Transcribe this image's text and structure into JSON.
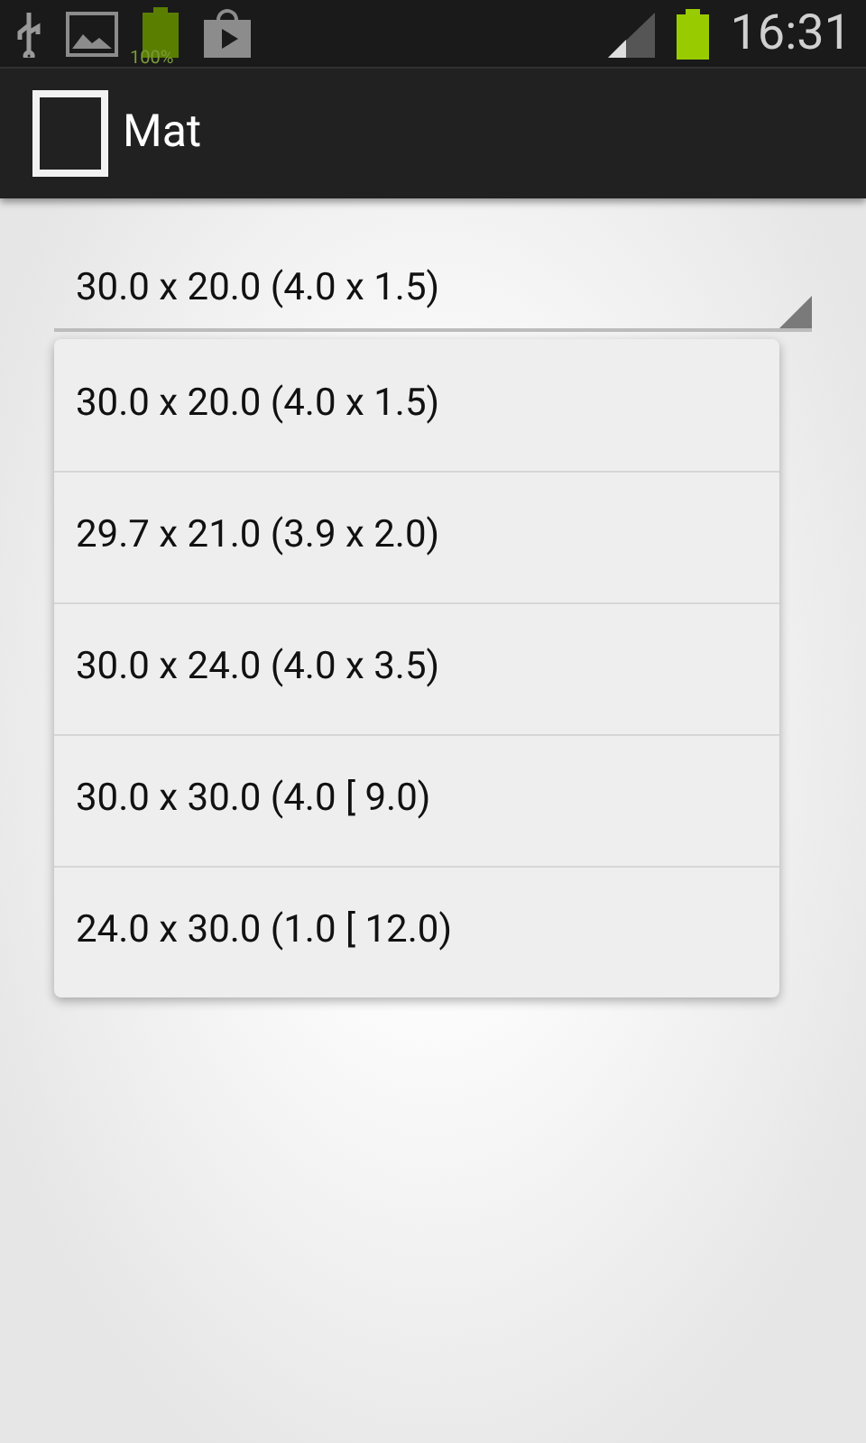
{
  "status_bar": {
    "battery_label": "100%",
    "time": "16:31"
  },
  "action_bar": {
    "title": "Mat"
  },
  "spinner": {
    "value": "30.0 x 20.0 (4.0 x 1.5)",
    "expanded": true,
    "options": [
      {
        "label": "30.0 x 20.0 (4.0 x 1.5)"
      },
      {
        "label": "29.7 x 21.0 (3.9 x 2.0)"
      },
      {
        "label": "30.0 x 24.0 (4.0 x 3.5)"
      },
      {
        "label": "30.0 x 30.0 (4.0 [ 9.0)"
      },
      {
        "label": "24.0 x 30.0 (1.0 [ 12.0)"
      }
    ]
  }
}
